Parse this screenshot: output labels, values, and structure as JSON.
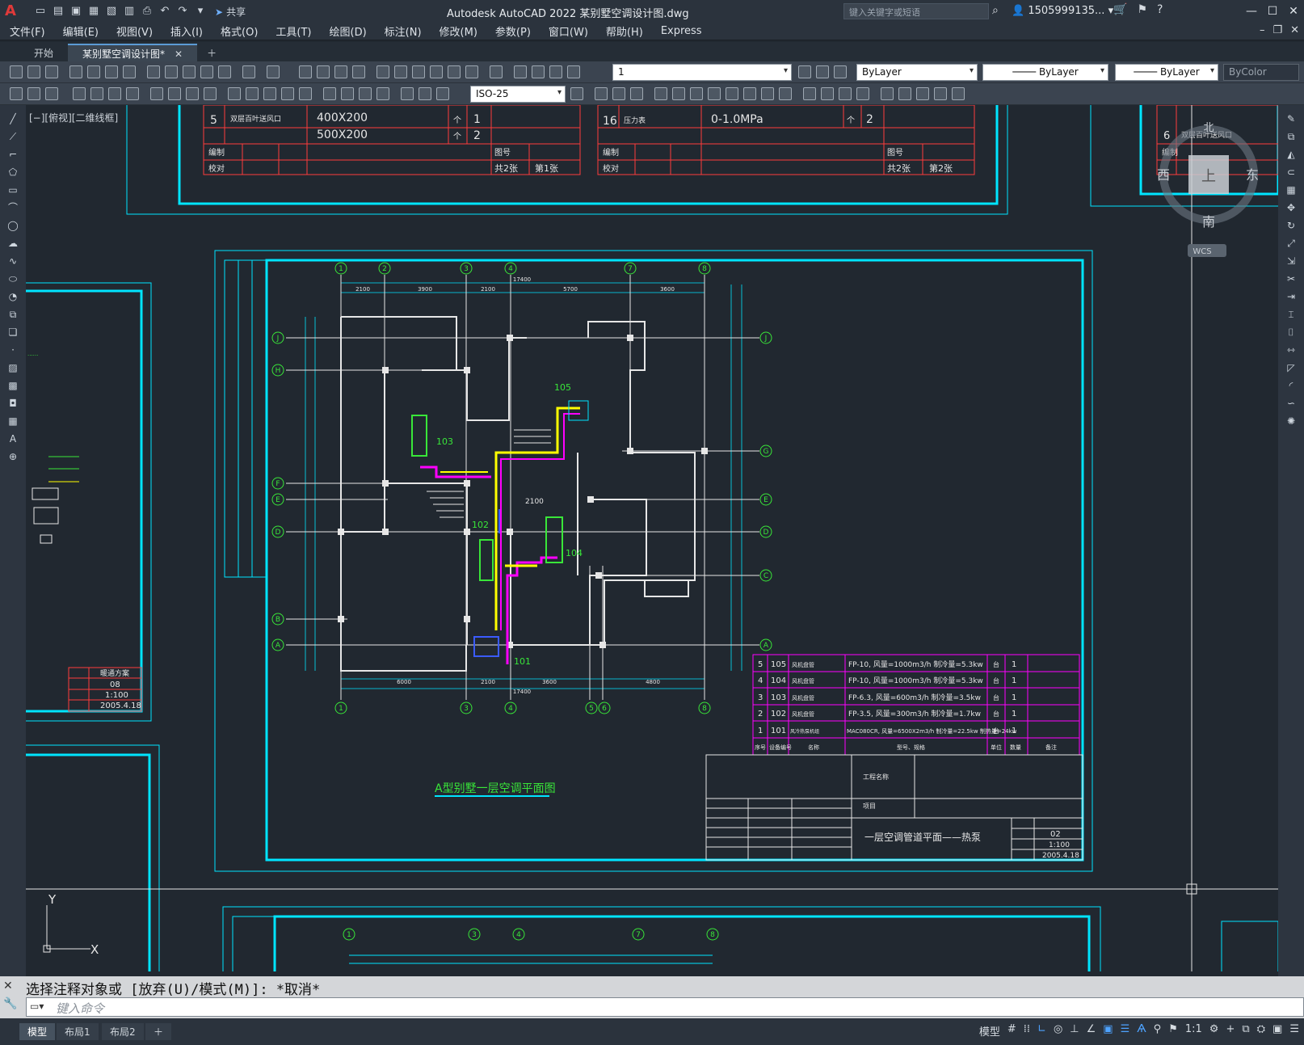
{
  "app": {
    "window_title": "Autodesk AutoCAD 2022    某别墅空调设计图.dwg",
    "share_label": "共享",
    "search_placeholder": "键入关键字或短语",
    "user": "1505999135...",
    "logo": "A"
  },
  "menu": {
    "items": [
      "文件(F)",
      "编辑(E)",
      "视图(V)",
      "插入(I)",
      "格式(O)",
      "工具(T)",
      "绘图(D)",
      "标注(N)",
      "修改(M)",
      "参数(P)",
      "窗口(W)",
      "帮助(H)",
      "Express"
    ]
  },
  "tabs": [
    {
      "label": "开始"
    },
    {
      "label": "某别墅空调设计图*"
    }
  ],
  "toolbar": {
    "layer_value": "1",
    "color_value": "ByLayer",
    "linetype_value": "ByLayer",
    "lineweight_value": "ByLayer",
    "plotstyle_value": "ByColor",
    "dimstyle_value": "ISO-25"
  },
  "viewport": {
    "label": "[−][俯视][二维线框]",
    "viewcube_top": "上",
    "viewcube_north": "北",
    "viewcube_south": "南",
    "viewcube_east": "东",
    "viewcube_west": "西",
    "wcs": "WCS"
  },
  "drawing": {
    "title": "A型别墅一层空调平面图",
    "drawing_name": "一层空调管道平面——热泵",
    "project_label": "工程名称",
    "item_label": "项目",
    "sheet_no": "02",
    "scale": "1:100",
    "date": "2005.4.18",
    "left_sheet_no": "08",
    "left_scale": "1:100",
    "left_date": "2005.4.18",
    "left_title": "暖通方案",
    "equipment": [
      {
        "no": "5",
        "code": "105",
        "name": "风机盘管",
        "spec": "FP-10, 风量=1000m3/h 制冷量=5.3kw",
        "unit": "台",
        "qty": "1"
      },
      {
        "no": "4",
        "code": "104",
        "name": "风机盘管",
        "spec": "FP-10, 风量=1000m3/h 制冷量=5.3kw",
        "unit": "台",
        "qty": "1"
      },
      {
        "no": "3",
        "code": "103",
        "name": "风机盘管",
        "spec": "FP-6.3, 风量=600m3/h 制冷量=3.5kw",
        "unit": "台",
        "qty": "1"
      },
      {
        "no": "2",
        "code": "102",
        "name": "风机盘管",
        "spec": "FP-3.5, 风量=300m3/h 制冷量=1.7kw",
        "unit": "台",
        "qty": "1"
      },
      {
        "no": "1",
        "code": "101",
        "name": "风冷热泵机组",
        "spec": "MAC080CR, 风量=6500X2m3/h 制冷量=22.5kw 制热量=24kw",
        "unit": "台",
        "qty": "1"
      }
    ],
    "equipment_headers": [
      "序号",
      "设备编号",
      "名称",
      "型号、规格",
      "单位",
      "数量",
      "备注"
    ],
    "top_table_left": [
      {
        "no": "5",
        "name": "双层百叶送风口",
        "spec": "400X200",
        "unit": "个",
        "qty": "1"
      },
      {
        "no": "",
        "name": "",
        "spec": "500X200",
        "unit": "个",
        "qty": "2"
      }
    ],
    "top_table_left_foot": {
      "edit": "编制",
      "check": "校对",
      "fig": "图号",
      "total": "共2张",
      "page": "第1张"
    },
    "top_table_right": [
      {
        "no": "16",
        "name": "压力表",
        "spec": "0-1.0MPa",
        "unit": "个",
        "qty": "2"
      }
    ],
    "top_table_right_foot": {
      "edit": "编制",
      "check": "校对",
      "fig": "图号",
      "total": "共2张",
      "page": "第2张"
    },
    "top_table_far": {
      "no": "6",
      "name": "双层百叶送风口",
      "edit": "编制"
    },
    "room_tags": [
      "105",
      "103",
      "102",
      "104",
      "101"
    ],
    "grid_top": [
      "1",
      "2",
      "3",
      "4",
      "7",
      "8"
    ],
    "grid_bottom": [
      "1",
      "3",
      "4",
      "5",
      "6",
      "8"
    ],
    "grid_left": [
      "J",
      "H",
      "F",
      "E",
      "D",
      "B",
      "A"
    ],
    "grid_right": [
      "J",
      "G",
      "E",
      "D",
      "C",
      "A"
    ],
    "grid_bottom_sheet": [
      "1",
      "3",
      "4",
      "7",
      "8"
    ],
    "dim_total": "17400",
    "dim_top": [
      "2100",
      "3900",
      "2100",
      "5700",
      "3600"
    ],
    "dim_bottom": [
      "6000",
      "2100",
      "3600",
      "4800"
    ],
    "pipe_note": "2100"
  },
  "ucs": {
    "x": "X",
    "y": "Y"
  },
  "command": {
    "history": "选择注释对象或 [放弃(U)/模式(M)]: *取消*",
    "placeholder": "键入命令"
  },
  "status": {
    "tabs": [
      "模型",
      "布局1",
      "布局2"
    ],
    "model_label": "模型",
    "scale": "1:1"
  },
  "colors": {
    "cyan": "#00e5ff",
    "white": "#e6e6e6",
    "green": "#39e639",
    "yellow": "#ffff00",
    "magenta": "#ff00ff",
    "red": "#ff3b3b",
    "blue": "#3b5bff"
  }
}
